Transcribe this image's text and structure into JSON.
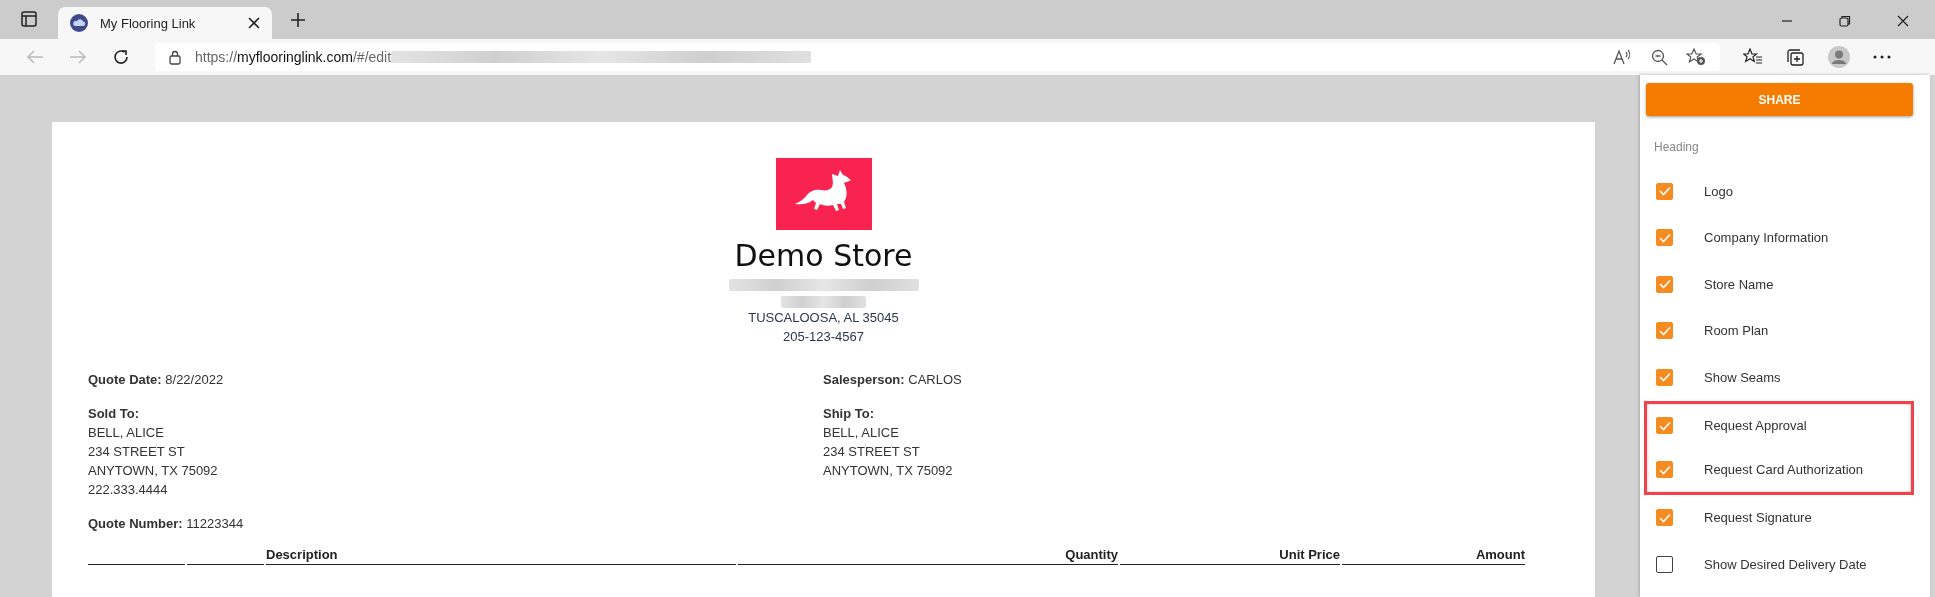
{
  "browser": {
    "tab_title": "My Flooring Link",
    "address": {
      "host_prefix": "https://",
      "host": "myflooringlink.com",
      "path": "/#/edit"
    }
  },
  "document": {
    "store_name": "Demo Store",
    "store_lines": [
      "TUSCALOOSA, AL 35045",
      "205-123-4567"
    ],
    "left": [
      {
        "label": "Quote Date:",
        "lines": [
          "8/22/2022"
        ],
        "kind": "inline"
      },
      {
        "label": "Sold To:",
        "lines": [
          "BELL, ALICE",
          "234 STREET ST",
          "ANYTOWN, TX 75092",
          "222.333.4444"
        ],
        "kind": "block"
      },
      {
        "label": "Quote Number:",
        "lines": [
          "11223344"
        ],
        "kind": "inline"
      }
    ],
    "right": [
      {
        "label": "Salesperson:",
        "lines": [
          "CARLOS"
        ],
        "kind": "inline"
      },
      {
        "label": "Ship To:",
        "lines": [
          "BELL, ALICE",
          "234 STREET ST",
          "ANYTOWN, TX 75092"
        ],
        "kind": "block"
      }
    ],
    "table": {
      "columns": [
        {
          "label": "Description",
          "kind": "text"
        },
        {
          "label": "Quantity",
          "kind": "number"
        },
        {
          "label": "Unit Price",
          "kind": "number"
        },
        {
          "label": "Amount",
          "kind": "number"
        }
      ]
    }
  },
  "panel": {
    "share_button": "SHARE",
    "section_title": "Heading",
    "options": [
      {
        "label": "Logo",
        "checked": true,
        "highlighted": false
      },
      {
        "label": "Company Information",
        "checked": true,
        "highlighted": false
      },
      {
        "label": "Store Name",
        "checked": true,
        "highlighted": false
      },
      {
        "label": "Room Plan",
        "checked": true,
        "highlighted": false
      },
      {
        "label": "Show Seams",
        "checked": true,
        "highlighted": false
      },
      {
        "label": "Request Approval",
        "checked": true,
        "highlighted": true
      },
      {
        "label": "Request Card Authorization",
        "checked": true,
        "highlighted": true
      },
      {
        "label": "Request Signature",
        "checked": true,
        "highlighted": false
      },
      {
        "label": "Show Desired Delivery Date",
        "checked": false,
        "highlighted": false
      }
    ]
  }
}
